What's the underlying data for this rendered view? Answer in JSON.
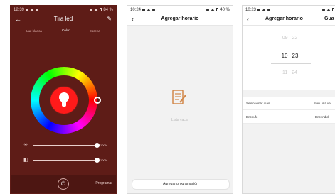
{
  "screen1": {
    "status_time": "12:39",
    "status_right": "84 %",
    "title": "Tira led",
    "tabs": [
      "Luz blanca",
      "Color",
      "Escena"
    ],
    "brightness_value": "100%",
    "temperature_value": "100%",
    "schedule_label": "Programar",
    "accent_color": "#ff1a1a",
    "background_color": "#5e1c17"
  },
  "screen2": {
    "status_time": "10:24",
    "status_right": "40 %",
    "title": "Agregar horario",
    "empty_text": "Lista vacía",
    "add_button_label": "Agregar programación"
  },
  "screen3": {
    "status_time": "10:23",
    "title": "Agregar horario",
    "save_label": "Gua",
    "picker": {
      "above": [
        "09",
        "22"
      ],
      "selected": [
        "10",
        "23"
      ],
      "below": [
        "11",
        "24"
      ]
    },
    "settings": [
      {
        "label": "Seleccionar días",
        "value": "Sólo una ve"
      },
      {
        "label": "Enchufe",
        "value": "Encendid"
      }
    ]
  }
}
